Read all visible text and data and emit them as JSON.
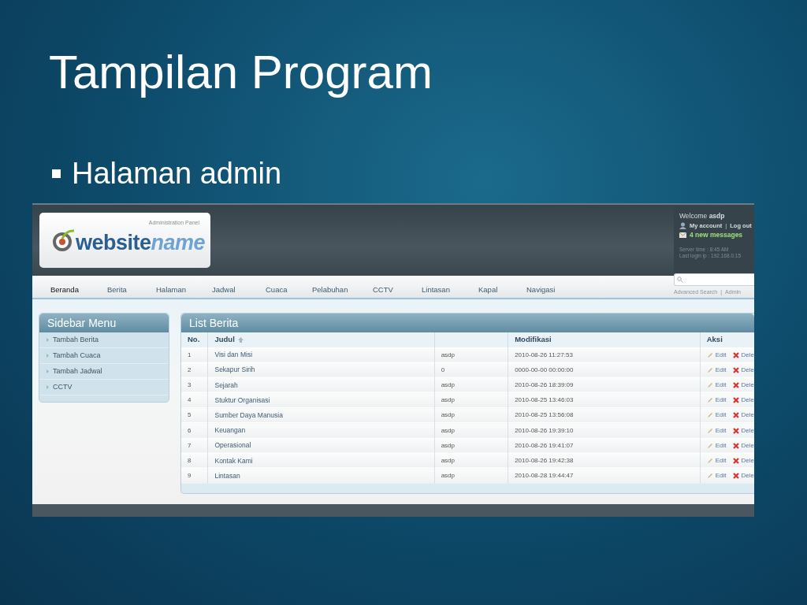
{
  "slide": {
    "title": "Tampilan Program",
    "bullets": [
      {
        "text": "Halaman admin"
      }
    ]
  },
  "screenshot": {
    "header": {
      "logo_tagline": "Administration Panel",
      "logo_text": {
        "first": "website",
        "second": "name"
      },
      "welcome": "Welcome **asdp**",
      "account_links": [
        {
          "label": "My account"
        },
        {
          "label": "Log out"
        }
      ],
      "link_separator": "|",
      "messages": "4 new messages",
      "server_time": "Server time : 8:45 AM",
      "last_login": "Last login ip : 192.168.0.15"
    },
    "nav": [
      {
        "label": "Beranda",
        "selected": true
      },
      {
        "label": "Berita",
        "selected": false
      },
      {
        "label": "Halaman",
        "selected": false
      },
      {
        "label": "Jadwal",
        "selected": false
      },
      {
        "label": "Cuaca",
        "selected": false
      },
      {
        "label": "Pelabuhan",
        "selected": false
      },
      {
        "label": "CCTV",
        "selected": false
      },
      {
        "label": "Lintasan",
        "selected": false
      },
      {
        "label": "Kapal",
        "selected": false
      },
      {
        "label": "Navigasi",
        "selected": false
      }
    ],
    "search": {
      "links": [
        "Advanced Search",
        "Admin"
      ],
      "separator": "|"
    },
    "sidebar": {
      "title": "Sidebar Menu",
      "items": [
        {
          "label": "Tambah Berita"
        },
        {
          "label": "Tambah Cuaca"
        },
        {
          "label": "Tambah Jadwal"
        },
        {
          "label": "CCTV"
        }
      ]
    },
    "table": {
      "title": "List Berita",
      "columns": [
        {
          "label": "No."
        },
        {
          "label": "Judul",
          "sorted": true
        },
        {},
        {
          "label": "Modifikasi"
        },
        {
          "label": "Aksi"
        }
      ],
      "rows": [
        {
          "no": "1",
          "judul": "Visi dan Misi",
          "column_3": "asdp",
          "modifikasi": "2010-08-26 11:27:53",
          "actions": [
            "Edit",
            "Dele"
          ]
        },
        {
          "no": "2",
          "judul": "Sekapur Sirih",
          "column_3": "0",
          "modifikasi": "0000-00-00 00:00:00",
          "actions": [
            "Edit",
            "Dele"
          ]
        },
        {
          "no": "3",
          "judul": "Sejarah",
          "column_3": "asdp",
          "modifikasi": "2010-08-26 18:39:09",
          "actions": [
            "Edit",
            "Dele"
          ]
        },
        {
          "no": "4",
          "judul": "Stuktur Organisasi",
          "column_3": "asdp",
          "modifikasi": "2010-08-25 13:46:03",
          "actions": [
            "Edit",
            "Dele"
          ]
        },
        {
          "no": "5",
          "judul": "Sumber Daya Manusia",
          "column_3": "asdp",
          "modifikasi": "2010-08-25 13:56:08",
          "actions": [
            "Edit",
            "Dele"
          ]
        },
        {
          "no": "6",
          "judul": "Keuangan",
          "column_3": "asdp",
          "modifikasi": "2010-08-26 19:39:10",
          "actions": [
            "Edit",
            "Dele"
          ]
        },
        {
          "no": "7",
          "judul": "Operasional",
          "column_3": "asdp",
          "modifikasi": "2010-08-26 19:41:07",
          "actions": [
            "Edit",
            "Dele"
          ]
        },
        {
          "no": "8",
          "judul": "Kontak Kami",
          "column_3": "asdp",
          "modifikasi": "2010-08-26 19:42:38",
          "actions": [
            "Edit",
            "Dele"
          ]
        },
        {
          "no": "9",
          "judul": "Lintasan",
          "column_3": "asdp",
          "modifikasi": "2010-08-28 19:44:47",
          "actions": [
            "Edit",
            "Dele"
          ]
        }
      ]
    }
  }
}
